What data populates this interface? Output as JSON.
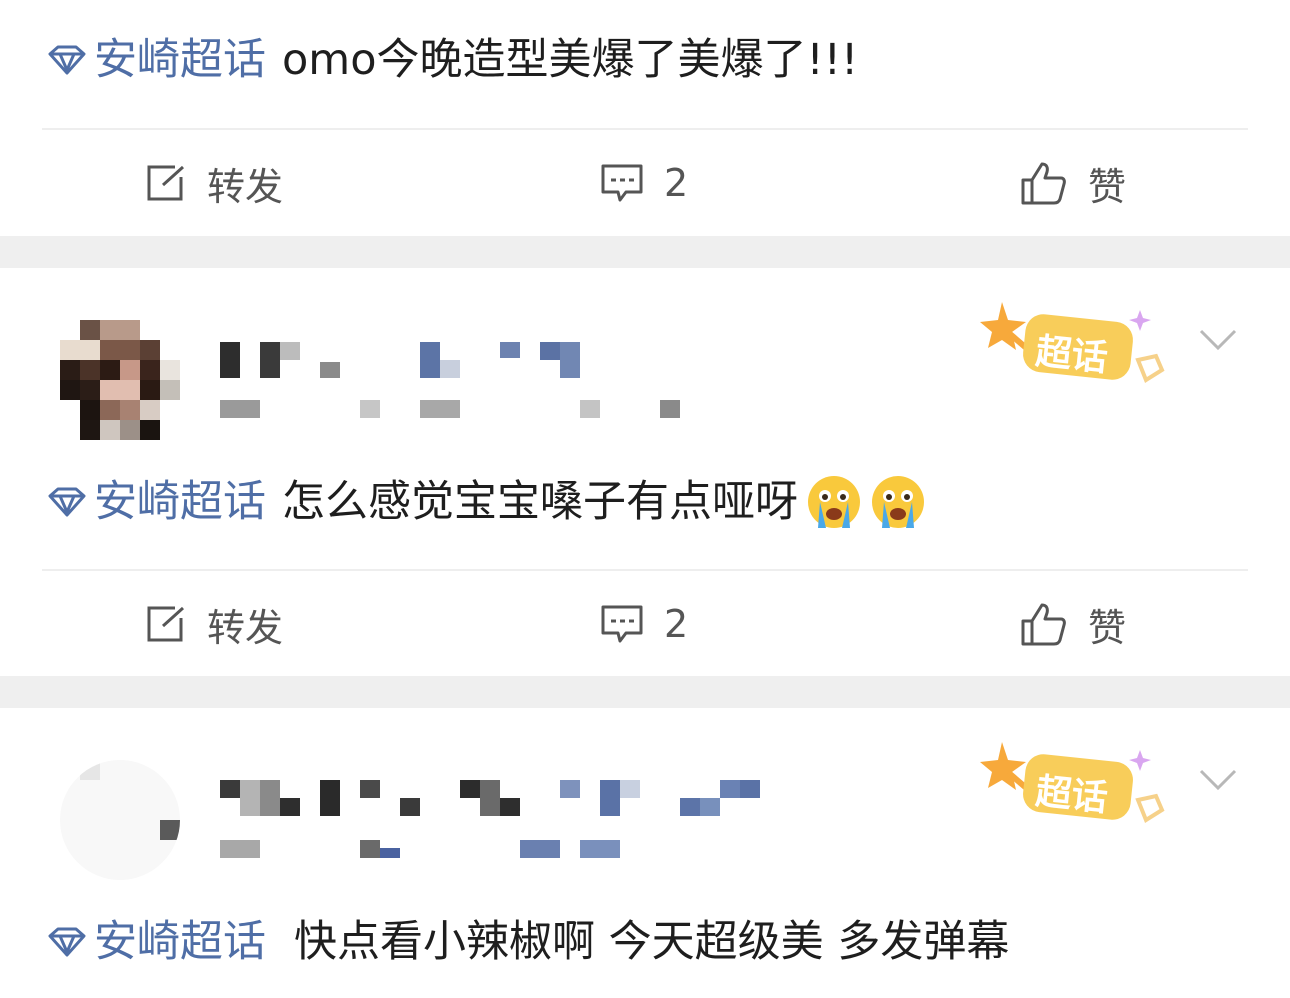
{
  "posts": [
    {
      "topic": "安崎超话",
      "text": "omo今晚造型美爆了美爆了!!!",
      "actions": {
        "repost": "转发",
        "comment_count": "2",
        "like": "赞"
      }
    },
    {
      "topic": "安崎超话",
      "text": "怎么感觉宝宝嗓子有点哑呀",
      "badge": "超话",
      "actions": {
        "repost": "转发",
        "comment_count": "2",
        "like": "赞"
      }
    },
    {
      "topic": "安崎超话",
      "text": "快点看小辣椒啊 今天超级美 多发弹幕",
      "badge": "超话"
    }
  ],
  "icons": {
    "topic": "diamond-icon",
    "repost": "share-edit-icon",
    "comment": "comment-icon",
    "like": "thumbs-up-icon",
    "menu": "chevron-down-icon",
    "emoji": "crying-face-emoji"
  },
  "colors": {
    "topic": "#4f6ea6",
    "text": "#1e1e1e",
    "action": "#555555",
    "badge": "#f7c948",
    "separator": "#efefef"
  }
}
